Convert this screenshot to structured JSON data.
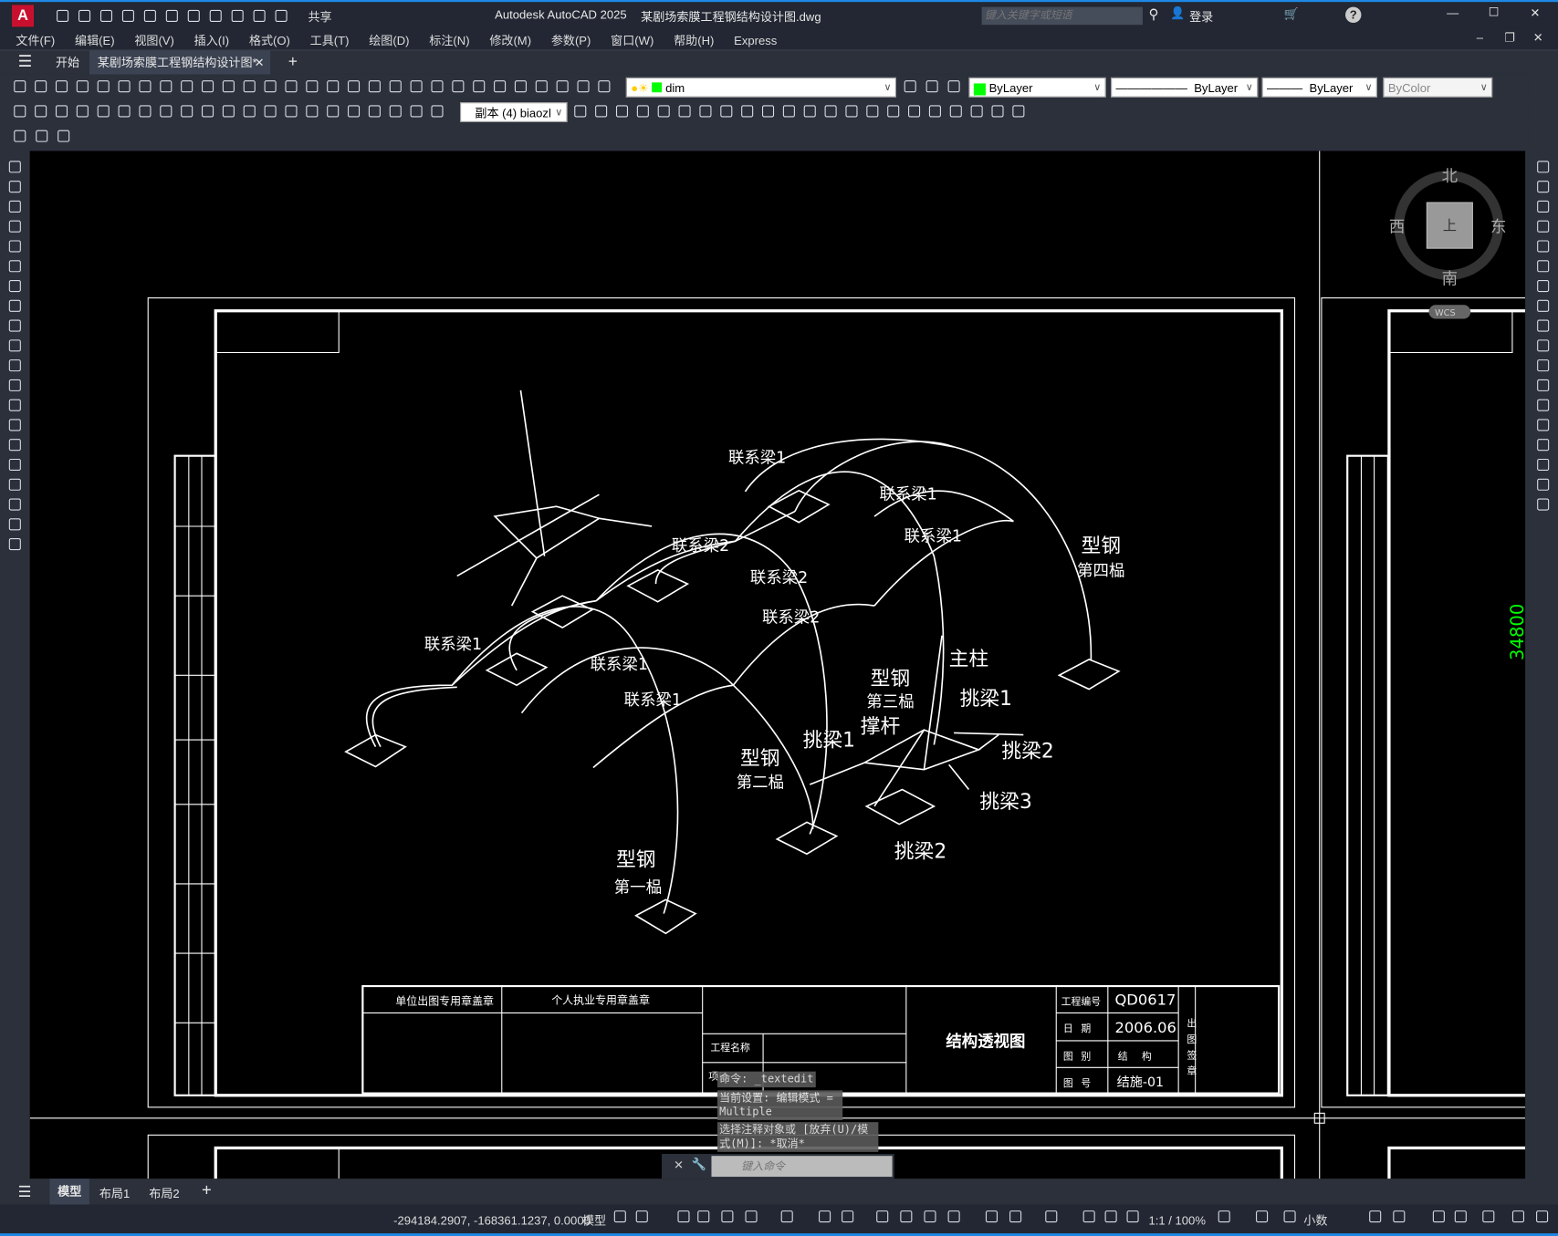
{
  "app": {
    "logo": "A",
    "title": "Autodesk AutoCAD 2025",
    "filename": "某剧场索膜工程钢结构设计图.dwg",
    "share": "共享",
    "search_placeholder": "键入关键字或短语",
    "login": "登录"
  },
  "menu": [
    "文件(F)",
    "编辑(E)",
    "视图(V)",
    "插入(I)",
    "格式(O)",
    "工具(T)",
    "绘图(D)",
    "标注(N)",
    "修改(M)",
    "参数(P)",
    "窗口(W)",
    "帮助(H)",
    "Express"
  ],
  "tabs": {
    "start": "开始",
    "active": "某剧场索膜工程钢结构设计图*"
  },
  "properties": {
    "layer": "dim",
    "color": "ByLayer",
    "linetype": "ByLayer",
    "lineweight": "ByLayer",
    "plotstyle": "ByColor",
    "dimstyle": "副本 (4) biaozl"
  },
  "compass": {
    "north": "北",
    "south": "南",
    "east": "东",
    "west": "西",
    "top": "上",
    "wcs": "WCS"
  },
  "dimension": "34800",
  "drawing_labels": {
    "lxl1": "联系梁1",
    "lxl2": "联系梁2",
    "xg": "型钢",
    "p4": "第四榀",
    "p3": "第三榀",
    "p2": "第二榀",
    "p1": "第一榀",
    "zz": "主柱",
    "cg": "撑杆",
    "tl1": "挑梁1",
    "tl2": "挑梁2",
    "tl3": "挑梁3"
  },
  "title_block": {
    "unit_seal": "单位出图专用章盖章",
    "personal_seal": "个人执业专用章盖章",
    "project_name": "工程名称",
    "item": "项目",
    "drawing_title": "结构透视图",
    "proj_no_label": "工程编号",
    "proj_no": "QD0617",
    "date_label": "日期",
    "date": "2006.06",
    "category_label": "图别",
    "category": "结构",
    "number_label": "图号",
    "number": "结施-01",
    "seal": "出图签章"
  },
  "command": {
    "line1": "命令: _textedit",
    "line2": "当前设置: 编辑模式 = Multiple",
    "line3": "选择注释对象或 [放弃(U)/模式(M)]: *取消*",
    "placeholder": "键入命令"
  },
  "layouts": [
    "模型",
    "布局1",
    "布局2"
  ],
  "status": {
    "coords": "-294184.2907, -168361.1237, 0.0000",
    "model": "模型",
    "scale": "1:1 / 100%",
    "units": "小数"
  }
}
